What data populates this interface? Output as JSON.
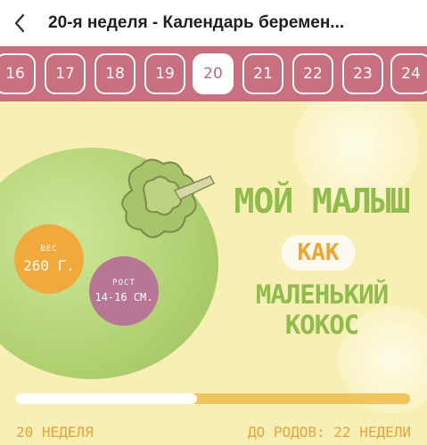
{
  "header": {
    "title": "20-я неделя - Календарь беремен..."
  },
  "weeks": {
    "items": [
      "16",
      "17",
      "18",
      "19",
      "20",
      "21",
      "22",
      "23",
      "24"
    ],
    "selected": "20"
  },
  "hero": {
    "weight_label": "ВЕС",
    "weight_value": "260 Г.",
    "height_label": "РОСТ",
    "height_value": "14-16 СМ.",
    "line1": "МОЙ МАЛЫШ",
    "line2": "КАК",
    "line3": "МАЛЕНЬКИЙ КОКОС",
    "progress_fraction": 0.46,
    "current_week_text": "20 НЕДЕЛЯ",
    "remaining_text": "ДО РОДОВ: 22 НЕДЕЛИ"
  },
  "colors": {
    "weekbar": "#c8707f",
    "hero_bg": "#f8efb4",
    "headline_green": "#8fbc4c",
    "accent_orange": "#f0a531",
    "badge_weight": "#f2a93c",
    "badge_height": "#b67694"
  },
  "icons": {
    "back": "chevron-left-icon"
  }
}
